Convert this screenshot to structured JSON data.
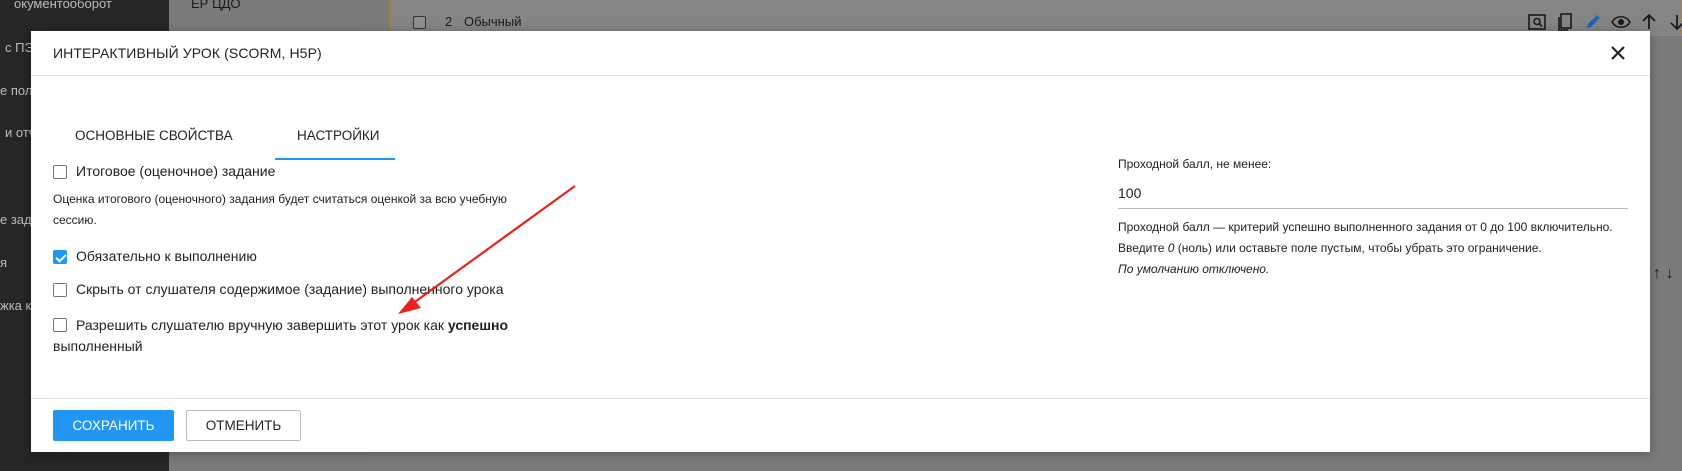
{
  "background": {
    "sidebar_items": [
      "окументооборот",
      "с ПЭ",
      "е пол",
      "и отч",
      "е зада",
      "я",
      "жка ко"
    ],
    "mid_text": "ЕР ЦДО",
    "row": {
      "number": "2",
      "name": "Обычный"
    }
  },
  "modal": {
    "title": "ИНТЕРАКТИВНЫЙ УРОК (SCORM, H5P)",
    "tabs": [
      {
        "label": "ОСНОВНЫЕ СВОЙСТВА",
        "active": false
      },
      {
        "label": "НАСТРОЙКИ",
        "active": true
      }
    ],
    "settings": {
      "final_task": {
        "label": "Итоговое (оценочное) задание",
        "checked": false
      },
      "final_task_help": "Оценка итогового (оценочного) задания будет считаться оценкой за всю учебную сессию.",
      "required": {
        "label": "Обязательно к выполнению",
        "checked": true
      },
      "hide_content": {
        "label": "Скрыть от слушателя содержимое (задание) выполненного урока",
        "checked": false
      },
      "allow_complete": {
        "label_prefix": "Разрешить слушателю вручную завершить этот урок как ",
        "label_bold": "успешно",
        "label_suffix": " выполненный",
        "checked": false
      },
      "passing_score": {
        "label": "Проходной балл, не менее:",
        "value": "100",
        "help_1": "Проходной балл — критерий успешно выполненного задания от 0 до 100 включительно. Введите ",
        "help_zero": "0",
        "help_2": " (ноль) или оставьте поле пустым, чтобы убрать это ограничение.",
        "default_note": "По умолчанию отключено."
      }
    },
    "footer": {
      "save_label": "СОХРАНИТЬ",
      "cancel_label": "ОТМЕНИТЬ"
    }
  },
  "colors": {
    "accent": "#2196f3",
    "annotation_arrow": "#e8221c"
  }
}
